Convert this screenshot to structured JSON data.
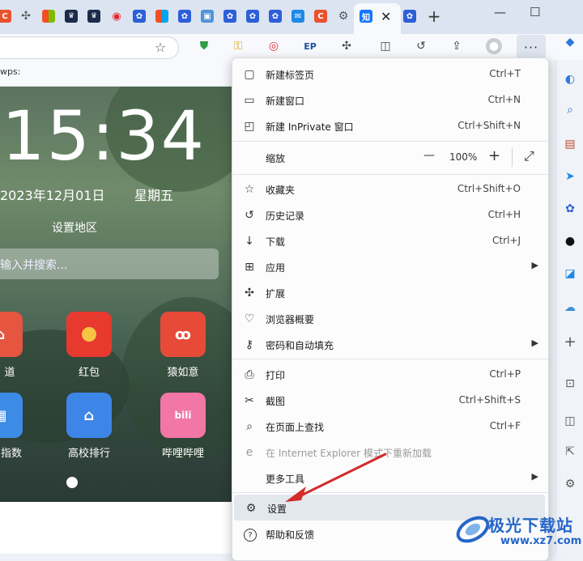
{
  "tabs": {
    "favicons": [
      "C",
      "puzzle",
      "ms",
      "king",
      "king",
      "weibo",
      "paw",
      "ms",
      "paw",
      "img",
      "paw",
      "paw",
      "paw",
      "mail",
      "C",
      "gear",
      "知",
      "paw"
    ],
    "active_favicon": "知",
    "new_tab_label": "+"
  },
  "window": {
    "minimize": "—",
    "maximize": "☐"
  },
  "favorites_bar": {
    "item": "wps:"
  },
  "page": {
    "clock": "15:34",
    "date": "2023年12月01日",
    "weekday": "星期五",
    "region_link": "设置地区",
    "search_placeholder": "输入并搜索...",
    "apps": [
      {
        "label": "道",
        "color": "#e5553f"
      },
      {
        "label": "红包",
        "color": "#e8392e"
      },
      {
        "label": "猿如意",
        "color": "#e74b38"
      },
      {
        "label": "指数",
        "color": "#3c8be5"
      },
      {
        "label": "高校排行",
        "color": "#3d86e8"
      },
      {
        "label": "哔哩哔哩",
        "color": "#f276a6"
      }
    ]
  },
  "menu": {
    "items": [
      {
        "icon": "new-tab-icon",
        "glyph": "▢",
        "label": "新建标签页",
        "shortcut": "Ctrl+T"
      },
      {
        "icon": "new-window-icon",
        "glyph": "▭",
        "label": "新建窗口",
        "shortcut": "Ctrl+N"
      },
      {
        "icon": "inprivate-icon",
        "glyph": "◰",
        "label": "新建 InPrivate 窗口",
        "shortcut": "Ctrl+Shift+N"
      },
      {
        "icon": "favorites-icon",
        "glyph": "☆",
        "label": "收藏夹",
        "shortcut": "Ctrl+Shift+O"
      },
      {
        "icon": "history-icon",
        "glyph": "↺",
        "label": "历史记录",
        "shortcut": "Ctrl+H"
      },
      {
        "icon": "download-icon",
        "glyph": "↓",
        "label": "下载",
        "shortcut": "Ctrl+J"
      },
      {
        "icon": "apps-icon",
        "glyph": "⊞",
        "label": "应用",
        "shortcut": ""
      },
      {
        "icon": "extensions-icon",
        "glyph": "✣",
        "label": "扩展",
        "shortcut": ""
      },
      {
        "icon": "browser-essentials-icon",
        "glyph": "♡",
        "label": "浏览器概要",
        "shortcut": ""
      },
      {
        "icon": "password-icon",
        "glyph": "⚷",
        "label": "密码和自动填充",
        "shortcut": ""
      },
      {
        "icon": "print-icon",
        "glyph": "⎙",
        "label": "打印",
        "shortcut": "Ctrl+P"
      },
      {
        "icon": "screenshot-icon",
        "glyph": "✂",
        "label": "截图",
        "shortcut": "Ctrl+Shift+S"
      },
      {
        "icon": "find-icon",
        "glyph": "⌕",
        "label": "在页面上查找",
        "shortcut": "Ctrl+F"
      },
      {
        "icon": "ie-mode-icon",
        "glyph": "e",
        "label": "在 Internet Explorer 模式下重新加载",
        "shortcut": ""
      },
      {
        "icon": "more-tools-icon",
        "glyph": "",
        "label": "更多工具",
        "shortcut": ""
      },
      {
        "icon": "settings-icon",
        "glyph": "⚙",
        "label": "设置",
        "shortcut": ""
      },
      {
        "icon": "help-icon",
        "glyph": "?",
        "label": "帮助和反馈",
        "shortcut": ""
      }
    ],
    "zoom": {
      "label": "缩放",
      "minus": "—",
      "value": "100%",
      "plus": "+",
      "fullscreen": "⤢"
    }
  },
  "watermark": {
    "title": "极光下载站",
    "url": "www.xz7.com"
  },
  "colors": {
    "highlight": "#e3e8ef",
    "arrow": "#d42a2a",
    "accent": "#2566c8"
  }
}
